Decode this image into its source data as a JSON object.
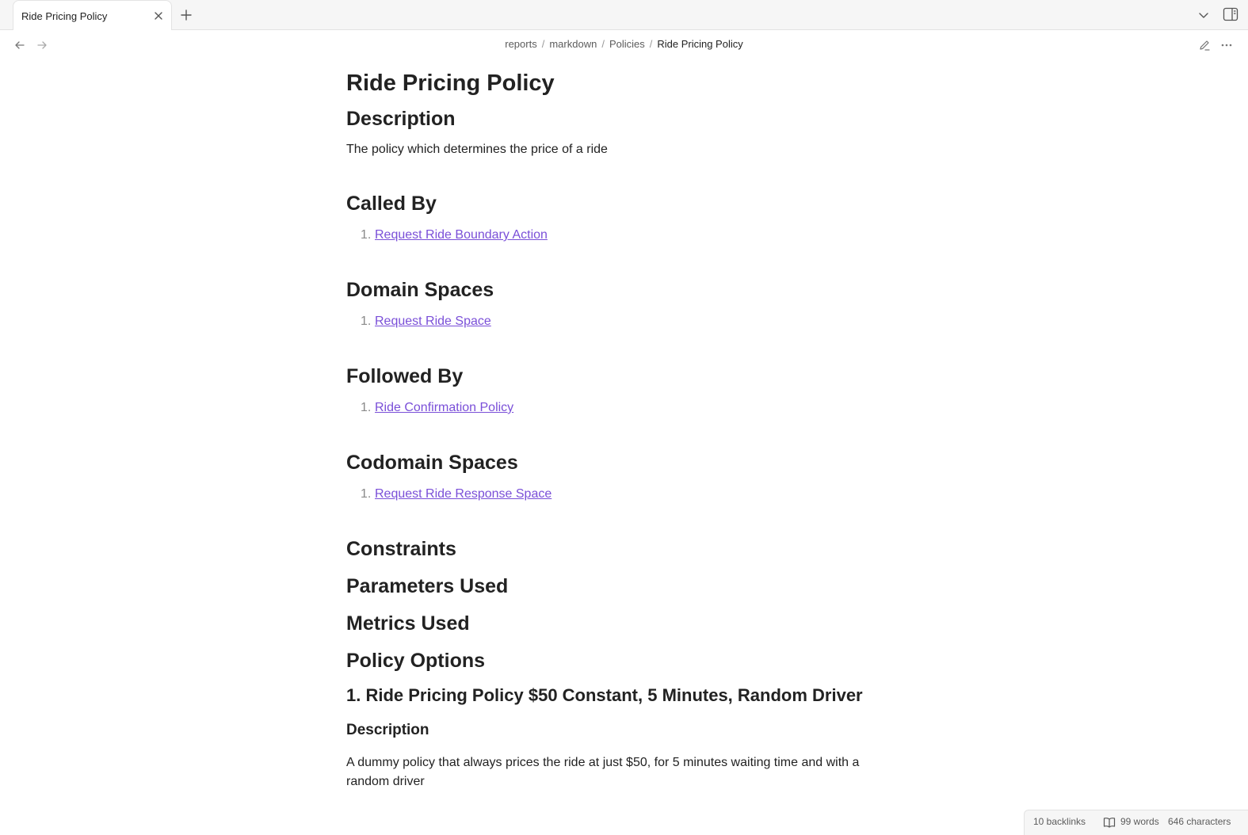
{
  "tabs": [
    {
      "title": "Ride Pricing Policy"
    }
  ],
  "breadcrumb": [
    "reports",
    "markdown",
    "Policies",
    "Ride Pricing Policy"
  ],
  "doc": {
    "title": "Ride Pricing Policy",
    "description_heading": "Description",
    "description": "The policy which determines the price of a ride",
    "called_by_heading": "Called By",
    "called_by": [
      {
        "num": "1.",
        "label": "Request Ride Boundary Action"
      }
    ],
    "domain_spaces_heading": "Domain Spaces",
    "domain_spaces": [
      {
        "num": "1.",
        "label": "Request Ride Space"
      }
    ],
    "followed_by_heading": "Followed By",
    "followed_by": [
      {
        "num": "1.",
        "label": "Ride Confirmation Policy"
      }
    ],
    "codomain_spaces_heading": "Codomain Spaces",
    "codomain_spaces": [
      {
        "num": "1.",
        "label": "Request Ride Response Space"
      }
    ],
    "constraints_heading": "Constraints",
    "parameters_heading": "Parameters Used",
    "metrics_heading": "Metrics Used",
    "policy_options_heading": "Policy Options",
    "option_1_heading": "1. Ride Pricing Policy $50 Constant, 5 Minutes, Random Driver",
    "option_1_description_heading": "Description",
    "option_1_description": "A dummy policy that always prices the ride at just $50, for 5 minutes waiting time and with a random driver"
  },
  "status": {
    "backlinks": "10 backlinks",
    "words": "99 words",
    "characters": "646 characters"
  },
  "colors": {
    "link": "#7a4fd8",
    "text": "#222222",
    "muted": "#5c5c5c"
  },
  "icons": [
    "close-icon",
    "plus-icon",
    "chevron-down-icon",
    "sidebar-toggle-icon",
    "arrow-left-icon",
    "arrow-right-icon",
    "pencil-icon",
    "more-horizontal-icon",
    "book-icon"
  ]
}
